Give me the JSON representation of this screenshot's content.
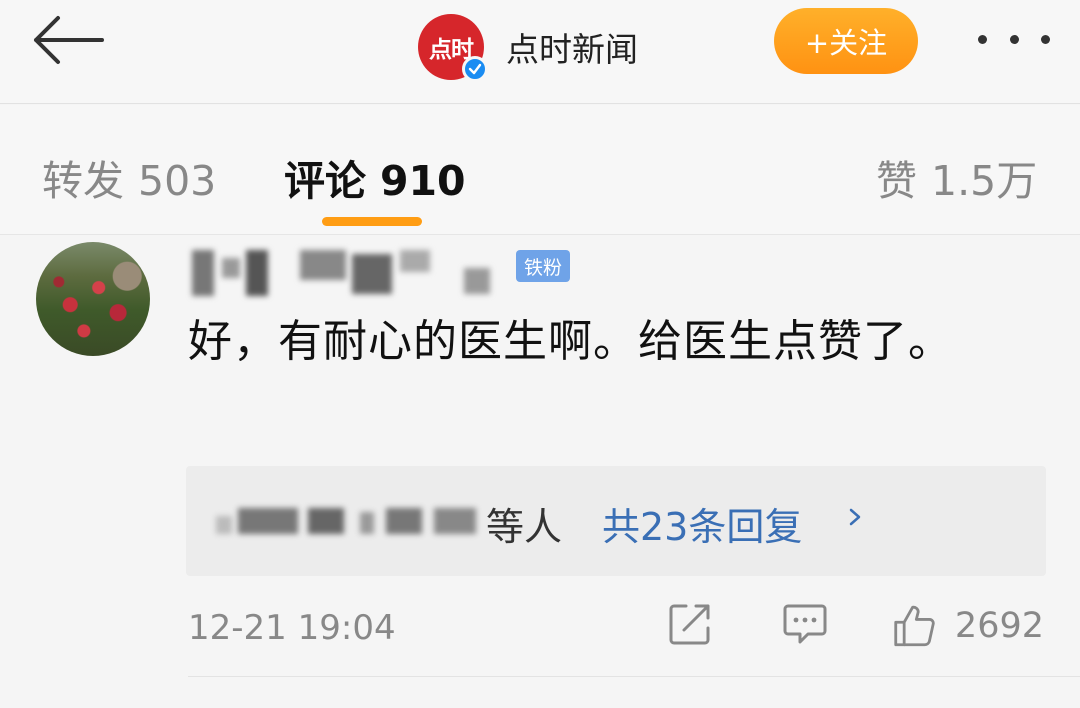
{
  "header": {
    "back_icon": "back-arrow-icon",
    "brand_logo_text": "点时",
    "brand_name": "点时新闻",
    "verified_icon": "verified-check-icon",
    "follow_label": "+关注",
    "more_icon": "more-dots-icon"
  },
  "tabs": [
    {
      "label": "转发",
      "count": "503",
      "active": false
    },
    {
      "label": "评论",
      "count": "910",
      "active": true
    },
    {
      "label": "赞",
      "count": "1.5万",
      "active": false
    }
  ],
  "accent_color": "#ff9d14",
  "link_color": "#3a6fb5",
  "comment": {
    "username": "",
    "badge": "铁粉",
    "text": "好，有耐心的医生啊。给医生点赞了。",
    "replies": {
      "people_suffix": "等人",
      "count_label": "共23条回复",
      "chevron_icon": "chevron-right-icon"
    },
    "time": "12-21 19:04",
    "share_icon": "share-icon",
    "comment_icon": "comment-icon",
    "like_icon": "thumbs-up-icon",
    "like_count": "2692"
  }
}
